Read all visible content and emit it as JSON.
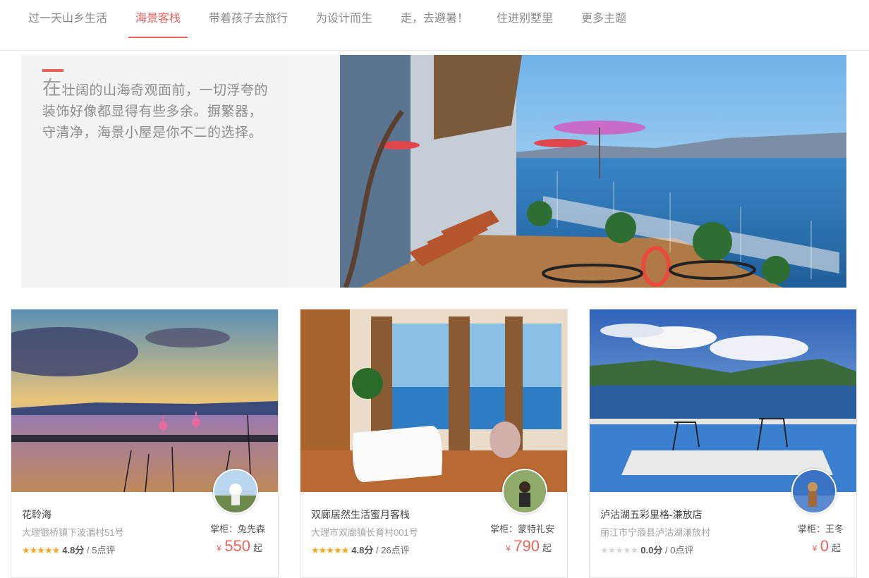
{
  "tabs": [
    {
      "label": "过一天山乡生活"
    },
    {
      "label": "海景客栈",
      "active": true
    },
    {
      "label": "带着孩子去旅行"
    },
    {
      "label": "为设计而生"
    },
    {
      "label": "走，去避暑！"
    },
    {
      "label": "住进别墅里"
    },
    {
      "label": "更多主题"
    }
  ],
  "hero": {
    "first_char": "在",
    "text": "壮阔的山海奇观面前，一切浮夸的装饰好像都显得有些多余。摒繁器，守清净，海景小屋是你不二的选择。",
    "image": "seaside-terrace-photo"
  },
  "cards": [
    {
      "name": "花聆海",
      "address": "大理银桥镇下波湄村51号",
      "host": "掌柜：兔先森",
      "stars": "★★★★★",
      "score": "4.8分",
      "reviews": "/ 5点评",
      "currency": "¥",
      "price": "550",
      "suffix": "起",
      "image": "lake-sunset-flamingo-photo"
    },
    {
      "name": "双廊居然生活蜜月客栈",
      "address": "大理市双廊镇长育村001号",
      "host": "掌柜：蒙特礼安",
      "stars": "★★★★★",
      "score": "4.8分",
      "reviews": "/ 26点评",
      "currency": "¥",
      "price": "790",
      "suffix": "起",
      "image": "bathtub-sea-view-room-photo"
    },
    {
      "name": "泸沽湖五彩里格-溓放店",
      "address": "丽江市宁蒗县泸沽湖溓放村",
      "host": "掌柜：王冬",
      "stars": "★★★★★",
      "score": "0.0分",
      "reviews": "/ 0点评",
      "currency": "¥",
      "price": "0",
      "suffix": "起",
      "image": "lake-terrace-chairs-photo"
    }
  ],
  "colors": {
    "accent": "#e9645c",
    "star": "#f5a623",
    "star_empty": "#d8d8d8"
  }
}
